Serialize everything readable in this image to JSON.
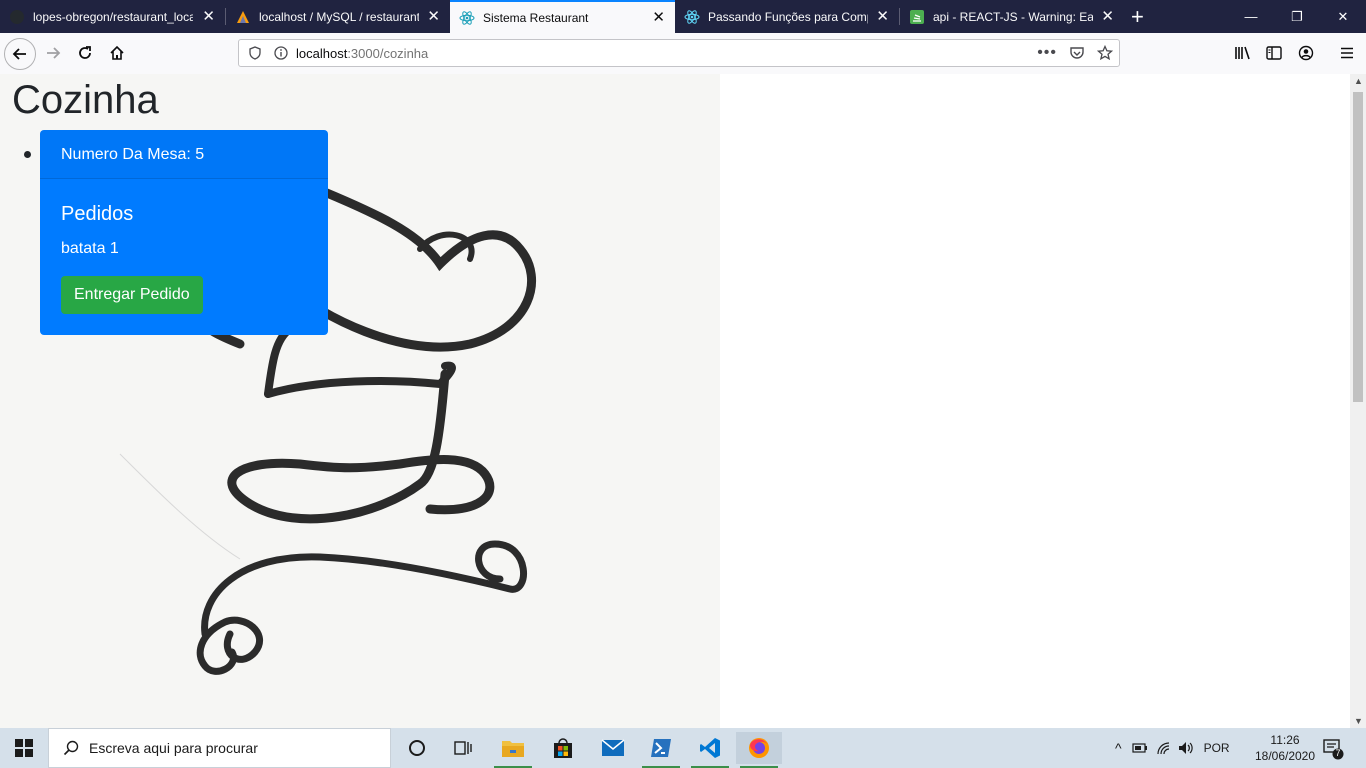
{
  "browser": {
    "tabs": [
      {
        "title": "lopes-obregon/restaurant_local",
        "icon": "github-icon"
      },
      {
        "title": "localhost / MySQL / restaurant",
        "icon": "phpmyadmin-icon"
      },
      {
        "title": "Sistema Restaurant",
        "icon": "react-icon",
        "active": true
      },
      {
        "title": "Passando Funções para Compo",
        "icon": "react-icon"
      },
      {
        "title": "api - REACT-JS - Warning: Each",
        "icon": "stackoverflow-icon"
      }
    ],
    "url_host": "localhost",
    "url_path": ":3000/cozinha"
  },
  "page": {
    "title": "Cozinha",
    "card": {
      "header": "Numero Da Mesa: 5",
      "title": "Pedidos",
      "item": "batata 1",
      "button": "Entregar Pedido"
    }
  },
  "taskbar": {
    "search_placeholder": "Escreva aqui para procurar",
    "lang": "POR",
    "time": "11:26",
    "date": "18/06/2020",
    "notifications": "7"
  },
  "colors": {
    "card_bg": "#007bff",
    "button_bg": "#28a745",
    "tab_active_accent": "#0a84ff"
  }
}
